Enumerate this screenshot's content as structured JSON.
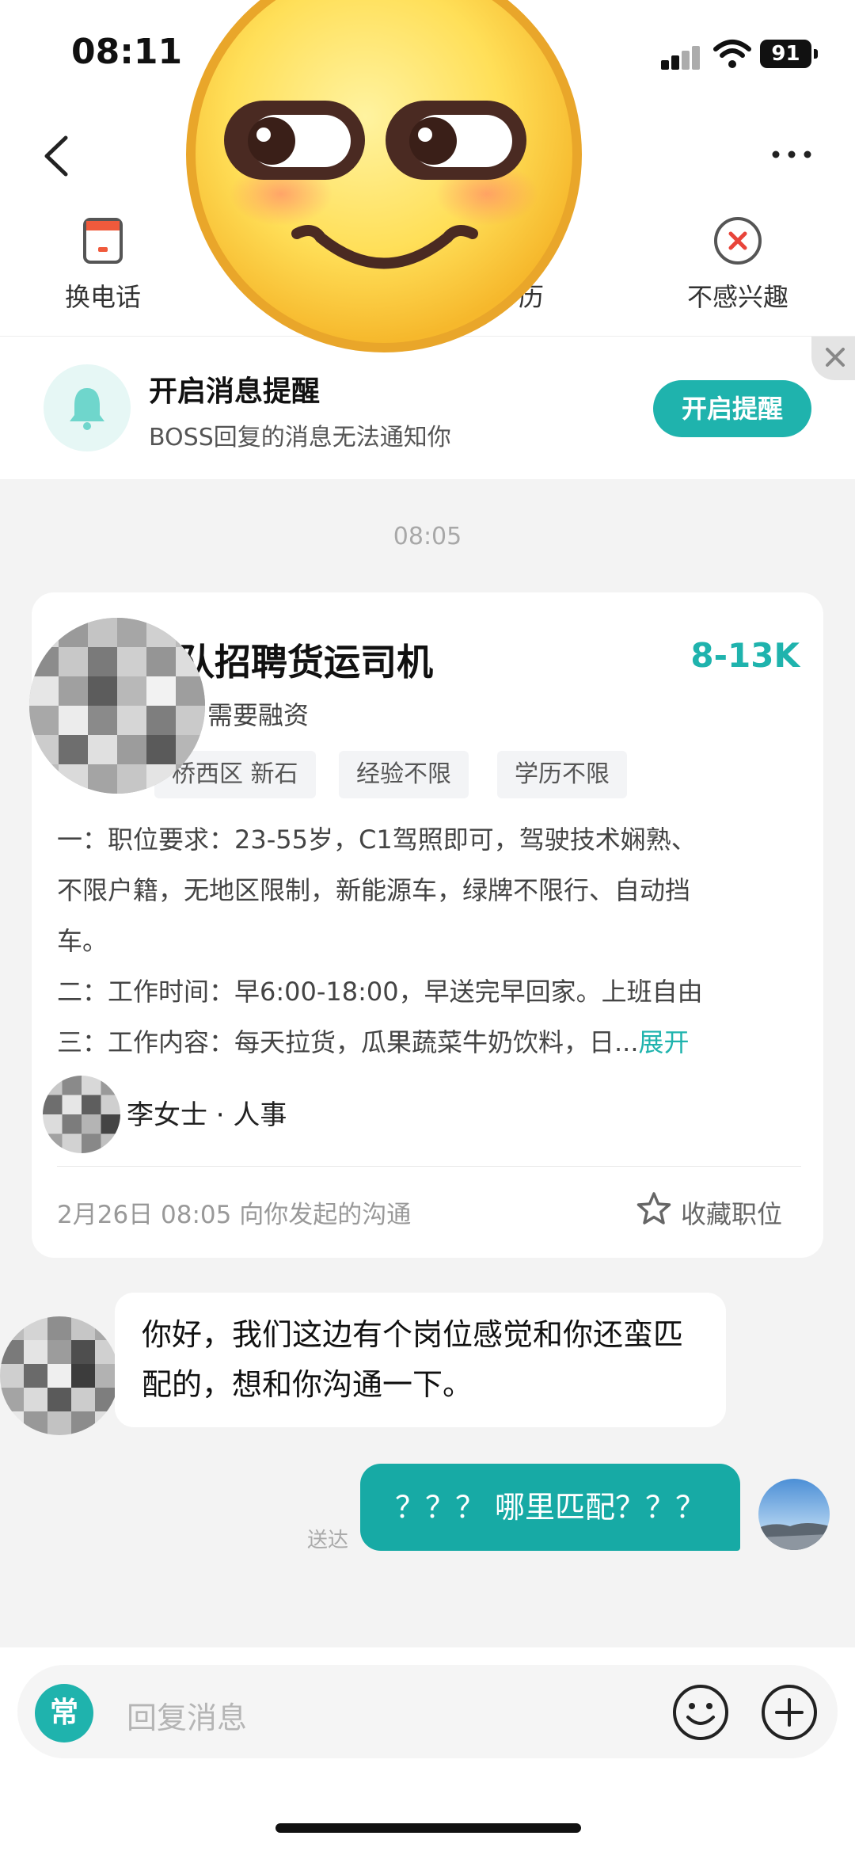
{
  "status_bar": {
    "time": "08:11",
    "battery": "91"
  },
  "actions": [
    {
      "label": "换电话",
      "icon": "phone-swap-icon"
    },
    {
      "label": "",
      "icon": "hidden-action-icon"
    },
    {
      "label": "历",
      "icon": "resume-icon"
    },
    {
      "label": "不感兴趣",
      "icon": "not-interested-icon"
    }
  ],
  "notify": {
    "title": "开启消息提醒",
    "subtitle": "BOSS回复的消息无法通知你",
    "button": "开启提醒"
  },
  "chat": {
    "time_divider": "08:05"
  },
  "job_card": {
    "title": "队招聘货运司机",
    "salary": "8-13K",
    "company": "需要融资",
    "tags": [
      "桥西区 新石",
      "经验不限",
      "学历不限"
    ],
    "description": [
      "一：职位要求：23-55岁，C1驾照即可，驾驶技术娴熟、",
      "不限户籍，无地区限制，新能源车，绿牌不限行、自动挡",
      "车。",
      "二：工作时间：早6:00-18:00，早送完早回家。上班自由"
    ],
    "description_last": "三：工作内容：每天拉货，瓜果蔬菜牛奶饮料，日...",
    "expand": "展开",
    "recruiter": "李女士 · 人事",
    "date_note": "2月26日 08:05 向你发起的沟通",
    "favorite": "收藏职位"
  },
  "messages": {
    "incoming": "你好，我们这边有个岗位感觉和你还蛮匹配的，想和你沟通一下。",
    "outgoing": "？？？ 哪里匹配？？？",
    "sent_status": "送达"
  },
  "input": {
    "quick": "常",
    "placeholder": "回复消息"
  },
  "colors": {
    "accent": "#1fb3ad",
    "bubble_out": "#17aaa5",
    "bell": "#6fd6cc"
  }
}
